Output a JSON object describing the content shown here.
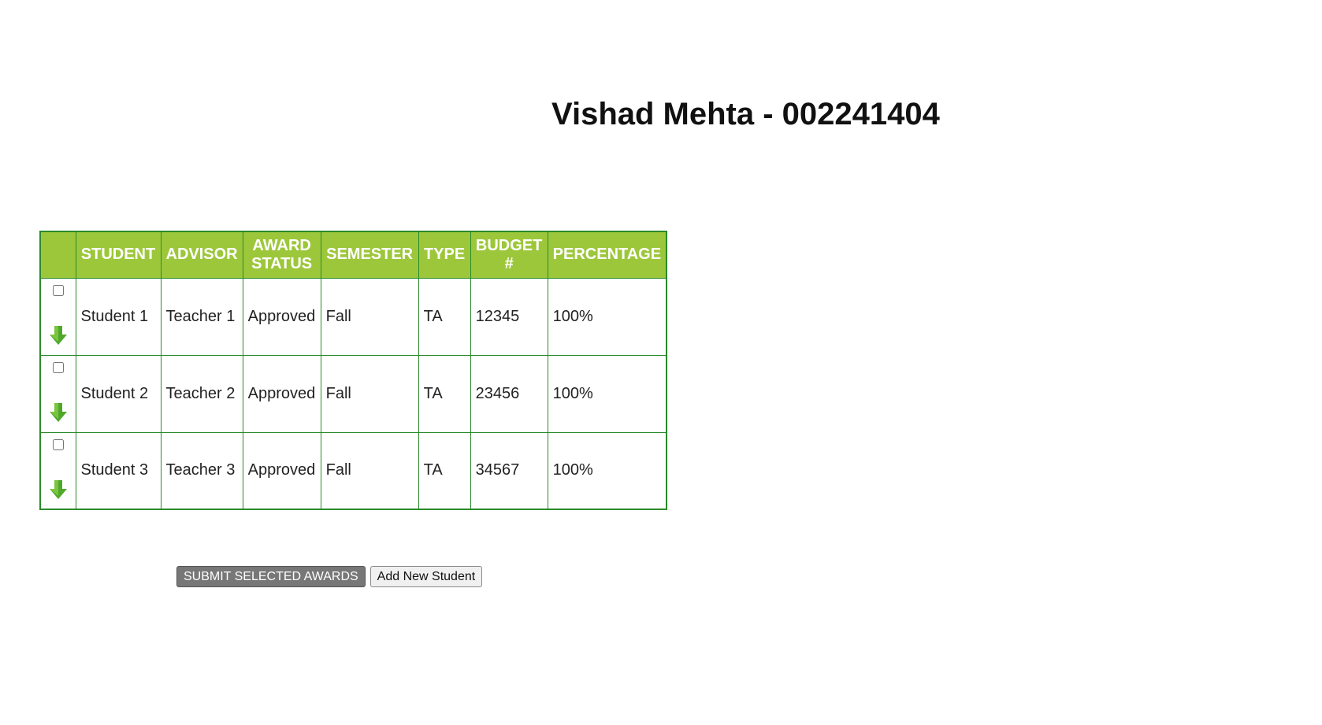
{
  "page": {
    "title": "Vishad Mehta - 002241404"
  },
  "table": {
    "headers": {
      "student": "STUDENT",
      "advisor": "ADVISOR",
      "award_status": "AWARD STATUS",
      "semester": "SEMESTER",
      "type": "TYPE",
      "budget": "BUDGET #",
      "percentage": "PERCENTAGE"
    },
    "rows": [
      {
        "student": "Student 1",
        "advisor": "Teacher 1",
        "award_status": "Approved",
        "semester": "Fall",
        "type": "TA",
        "budget": "12345",
        "percentage": "100%",
        "selected": false
      },
      {
        "student": "Student 2",
        "advisor": "Teacher 2",
        "award_status": "Approved",
        "semester": "Fall",
        "type": "TA",
        "budget": "23456",
        "percentage": "100%",
        "selected": false
      },
      {
        "student": "Student 3",
        "advisor": "Teacher 3",
        "award_status": "Approved",
        "semester": "Fall",
        "type": "TA",
        "budget": "34567",
        "percentage": "100%",
        "selected": false
      }
    ],
    "icons": {
      "row_expand": "arrow-down-icon"
    },
    "colors": {
      "header_bg": "#9dc73b",
      "border": "#2a8a2a",
      "arrow": "#4fa82a"
    }
  },
  "actions": {
    "submit_label": "SUBMIT SELECTED AWARDS",
    "add_label": "Add New Student"
  }
}
